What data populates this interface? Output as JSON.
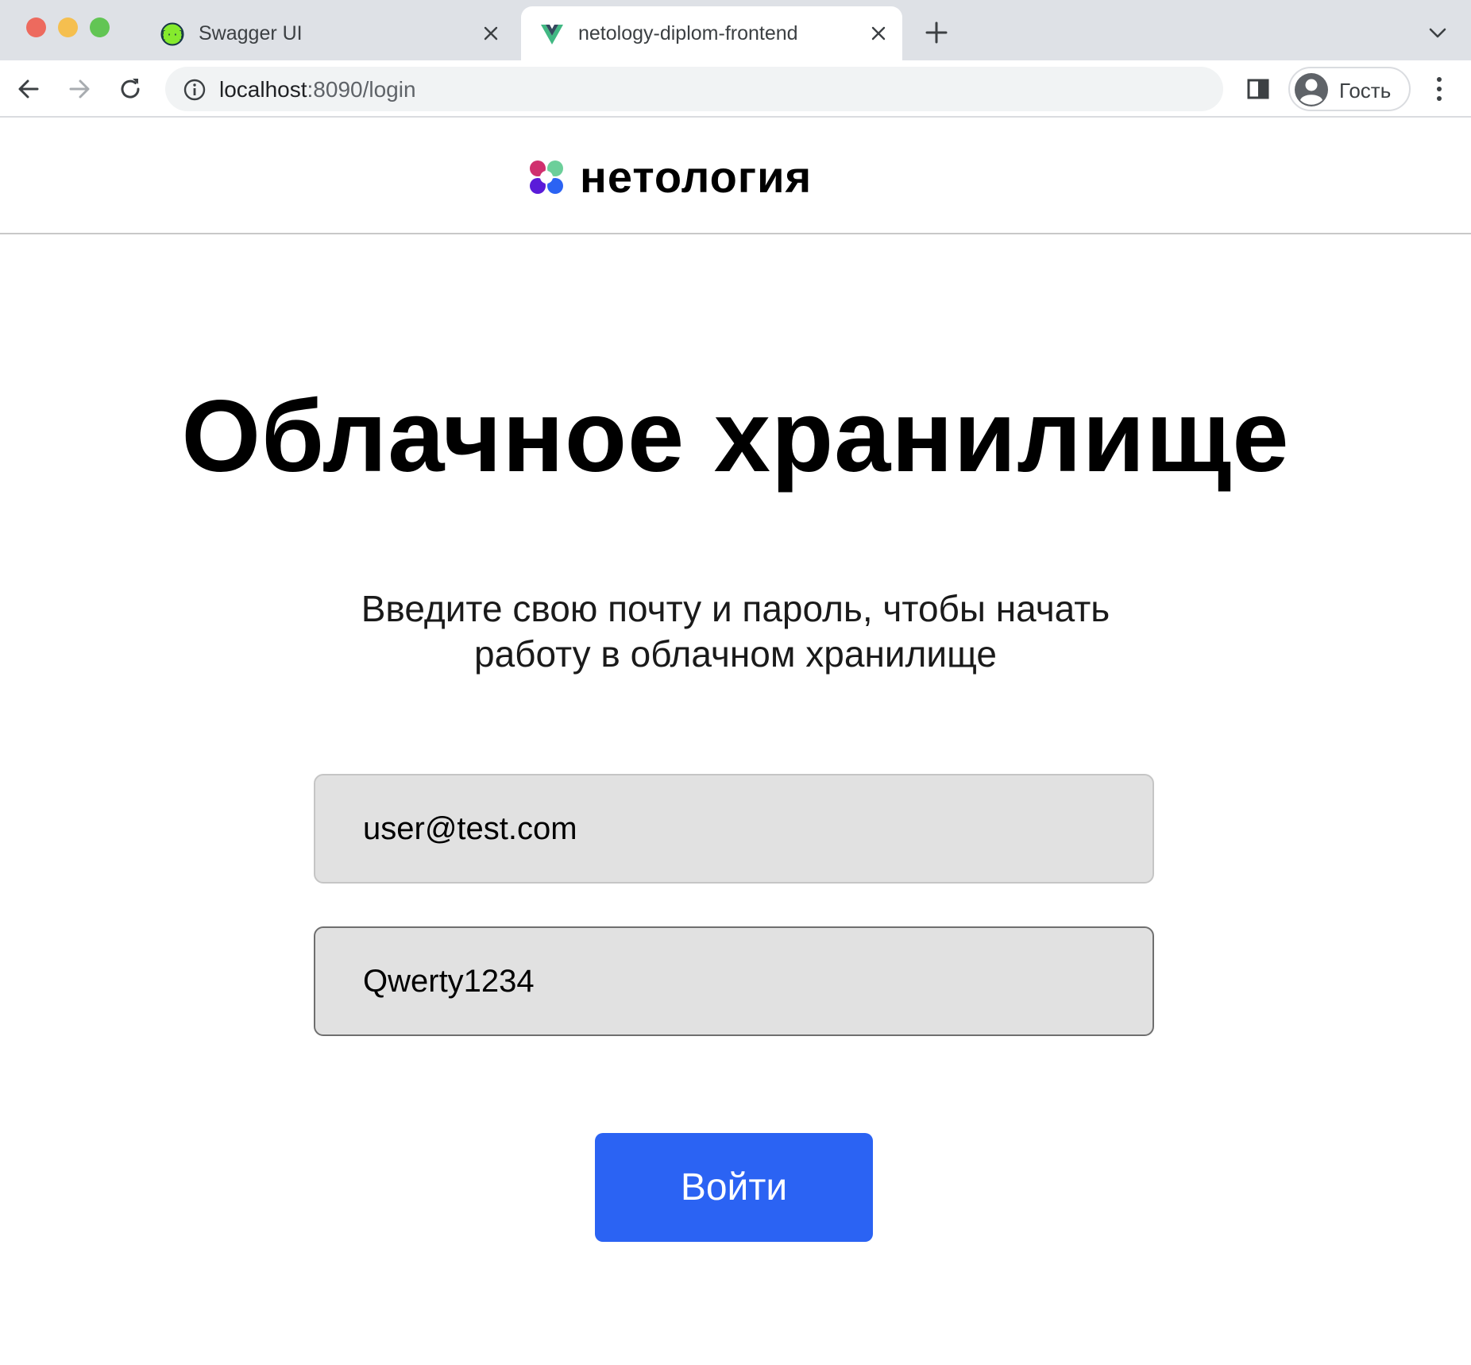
{
  "browser": {
    "tabs": [
      {
        "title": "Swagger UI",
        "favicon": "swagger-favicon",
        "active": false
      },
      {
        "title": "netology-diplom-frontend",
        "favicon": "vue-favicon",
        "active": true
      }
    ],
    "address": {
      "host": "localhost",
      "rest": ":8090/login"
    },
    "profile_label": "Гость",
    "colors": {
      "tabbar": "#dee1e6",
      "omnibox": "#f1f3f4"
    }
  },
  "site": {
    "logo_text": "нетология",
    "logo_colors": [
      "#d0306e",
      "#6ccf9a",
      "#5a1bd9",
      "#2b63f3"
    ]
  },
  "login": {
    "title": "Облачное хранилище",
    "subtitle_line1": "Введите свою почту и пароль, чтобы начать",
    "subtitle_line2": "работу в облачном хранилище",
    "email_value": "user@test.com",
    "password_value": "Qwerty1234",
    "submit_label": "Войти",
    "accent": "#2b63f3"
  }
}
